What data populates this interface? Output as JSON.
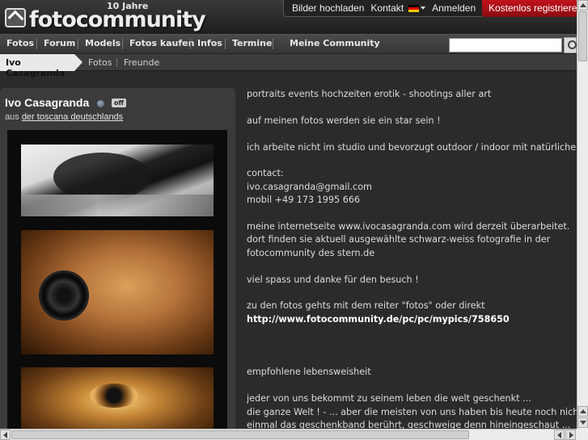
{
  "logo": {
    "brand": "fotocommunity",
    "anniversary": "10 Jahre"
  },
  "toplinks": {
    "upload": "Bilder hochladen",
    "contact": "Kontakt",
    "login": "Anmelden",
    "register": "Kostenlos registrieren"
  },
  "mainnav": [
    "Fotos",
    "Forum",
    "Models",
    "Fotos kaufen",
    "Infos",
    "Termine",
    "Meine Community"
  ],
  "search": {
    "value": "",
    "placeholder": ""
  },
  "subnav": {
    "current": "Ivo Casagranda",
    "items": [
      "Fotos",
      "Freunde"
    ]
  },
  "profile": {
    "name": "Ivo Casagranda",
    "status": "off",
    "from_prefix": "aus",
    "from_link": "der toscana deutschlands"
  },
  "content": {
    "lines": [
      "portraits events hochzeiten erotik - shootings aller art",
      "",
      "auf meinen fotos werden sie ein star sein !",
      "",
      "ich arbeite nicht im studio und bevorzugt outdoor / indoor mit natürlichem licht",
      "",
      "contact:",
      "ivo.casagranda@gmail.com",
      "mobil +49 173 1995 666",
      "",
      "meine internetseite www.ivocasagranda.com wird derzeit überarbeitet.",
      "dort finden sie aktuell ausgewählte schwarz-weiss fotografie in der",
      "fotocommunity des stern.de",
      "",
      "viel spass und danke für den besuch !",
      "",
      "zu den fotos gehts mit dem reiter \"fotos\" oder direkt",
      "http://www.fotocommunity.de/pc/pc/mypics/758650",
      "",
      "",
      "",
      "empfohlene lebensweisheit",
      "",
      "jeder von uns bekommt zu seinem leben die welt geschenkt ...",
      "die ganze Welt ! - ... aber die meisten von uns haben bis heute noch nicht",
      "einmal das geschenkband berührt, geschweige denn hineingeschaut ..."
    ]
  }
}
